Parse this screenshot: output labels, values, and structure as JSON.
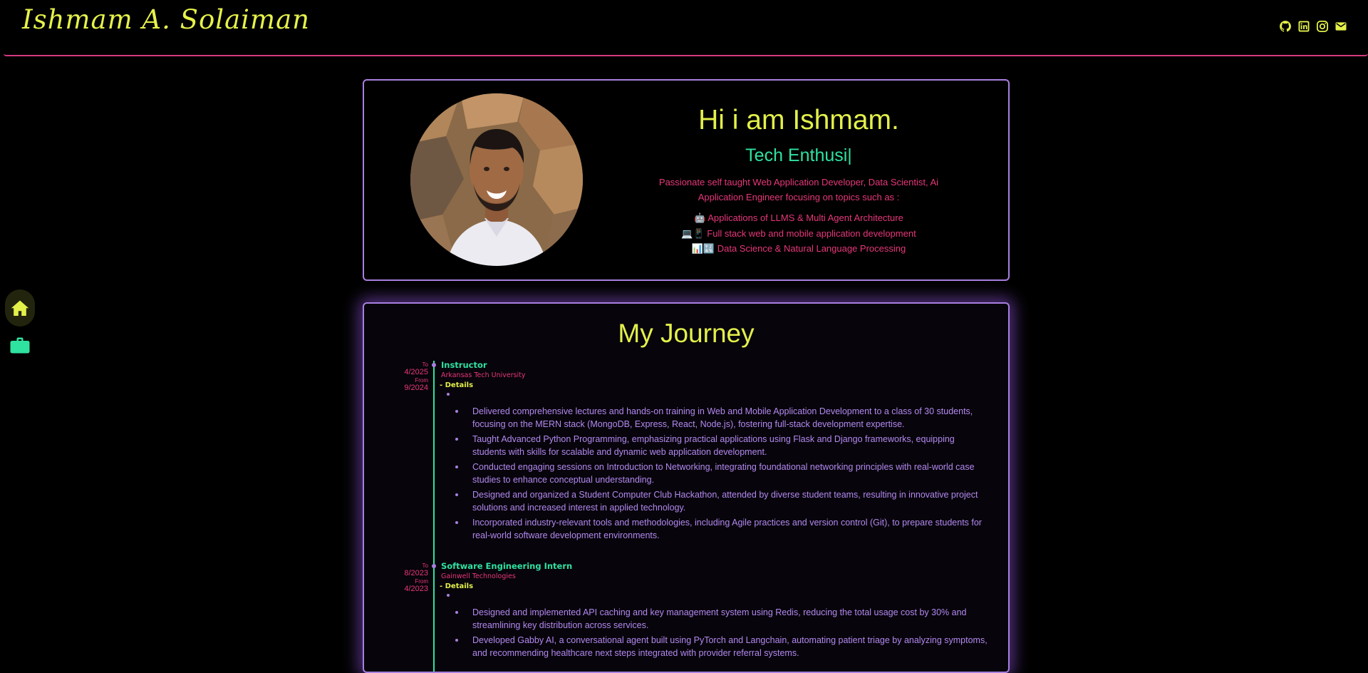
{
  "header": {
    "logo_text": "Ishmam A. Solaiman",
    "social_links": [
      {
        "name": "github-icon",
        "label": "GitHub"
      },
      {
        "name": "linkedin-icon",
        "label": "LinkedIn"
      },
      {
        "name": "instagram-icon",
        "label": "Instagram"
      },
      {
        "name": "mail-icon",
        "label": "Email"
      }
    ]
  },
  "sidenav": {
    "items": [
      {
        "icon": "home-icon",
        "active": true
      },
      {
        "icon": "briefcase-icon",
        "active": false
      }
    ]
  },
  "hero": {
    "greeting": "Hi i am Ishmam.",
    "typed_text": "Tech Enthusi|",
    "intro": "Passionate self taught Web Application Developer, Data Scientist, Ai Application Engineer focusing on topics such as :",
    "topics": [
      "🤖 Applications of LLMS & Multi Agent Architecture",
      "💻📱 Full stack web and mobile application development",
      "📊🔣 Data Science & Natural Language Processing"
    ]
  },
  "journey": {
    "title": "My Journey",
    "jobs": [
      {
        "to_label": "To",
        "to_date": "4/2025",
        "from_label": "From",
        "from_date": "9/2024",
        "role": "Instructor",
        "org": "Arkansas Tech University",
        "details_label": "- Details",
        "bullets": [
          "Delivered comprehensive lectures and hands-on training in Web and Mobile Application Development to a class of 30 students, focusing on the MERN stack (MongoDB, Express, React, Node.js), fostering full-stack development expertise.",
          "Taught Advanced Python Programming, emphasizing practical applications using Flask and Django frameworks, equipping students with skills for scalable and dynamic web application development.",
          "Conducted engaging sessions on Introduction to Networking, integrating foundational networking principles with real-world case studies to enhance conceptual understanding.",
          "Designed and organized a Student Computer Club Hackathon, attended by diverse student teams, resulting in innovative project solutions and increased interest in applied technology.",
          "Incorporated industry-relevant tools and methodologies, including Agile practices and version control (Git), to prepare students for real-world software development environments."
        ]
      },
      {
        "to_label": "To",
        "to_date": "8/2023",
        "from_label": "From",
        "from_date": "4/2023",
        "role": "Software Engineering Intern",
        "org": "Gainwell Technologies",
        "details_label": "- Details",
        "bullets": [
          "Designed and implemented API caching and key management system using Redis, reducing the total usage cost by 30% and streamlining key distribution across services.",
          "Developed Gabby AI, a conversational agent built using PyTorch and Langchain, automating patient triage by analyzing symptoms, and recommending healthcare next steps integrated with provider referral systems."
        ]
      }
    ]
  },
  "colors": {
    "accent_yellow": "#e3f04a",
    "accent_green": "#2fe2a0",
    "accent_pink": "#e6377a",
    "accent_purple": "#a87fe0"
  }
}
